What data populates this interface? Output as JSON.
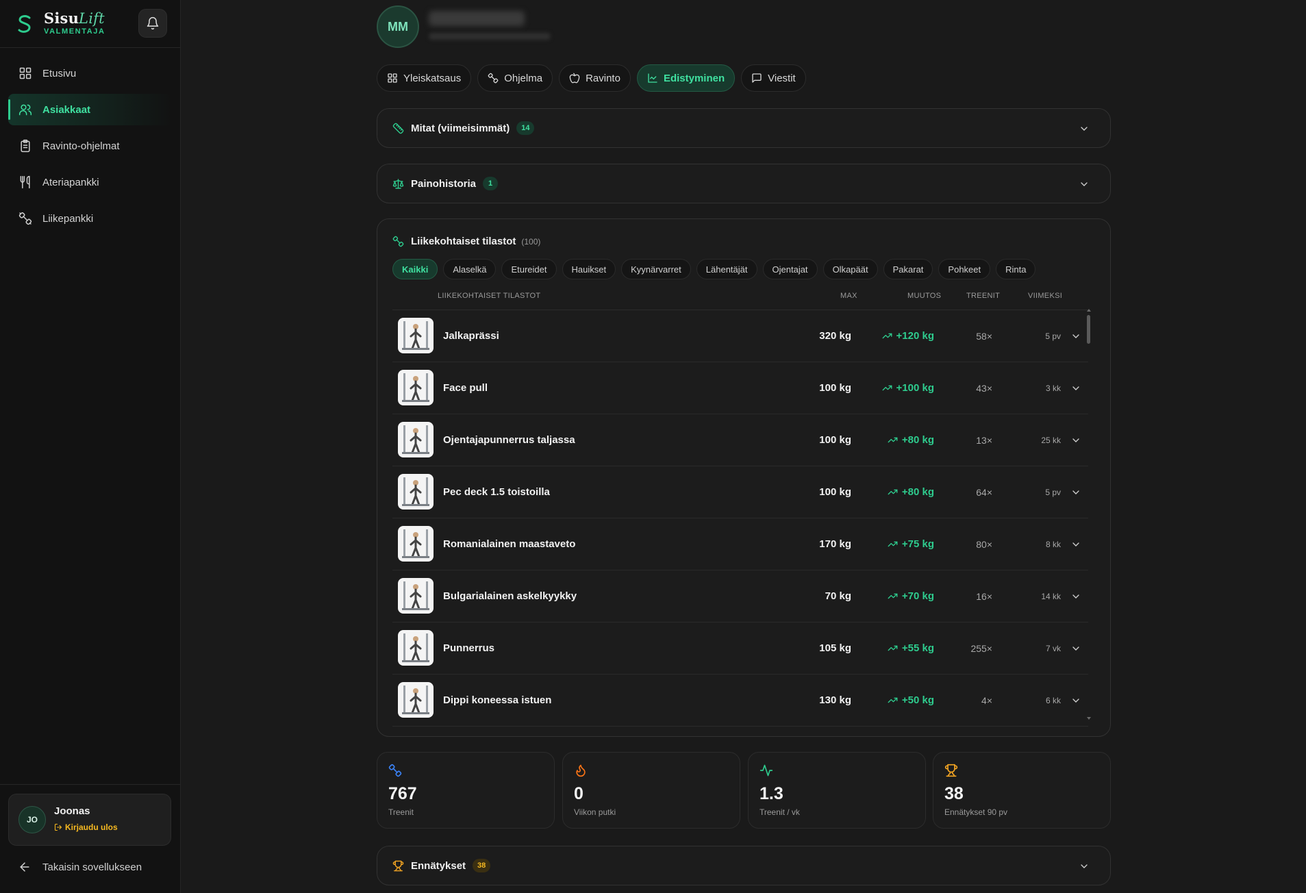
{
  "brand": {
    "name_a": "Sisu",
    "name_b": "Lift",
    "subtitle": "VALMENTAJA"
  },
  "colors": {
    "accent": "#2ecc8e",
    "gold": "#f5b820",
    "background": "#1a1a1a",
    "sidebar": "#121212"
  },
  "sidebar": {
    "items": [
      {
        "label": "Etusivu",
        "icon": "grid-icon"
      },
      {
        "label": "Asiakkaat",
        "icon": "users-icon",
        "active": true
      },
      {
        "label": "Ravinto-ohjelmat",
        "icon": "clipboard-icon"
      },
      {
        "label": "Ateriapankki",
        "icon": "utensils-icon"
      },
      {
        "label": "Liikepankki",
        "icon": "dumbbell-icon"
      }
    ],
    "user": {
      "initials": "JO",
      "name": "Joonas",
      "logout": "Kirjaudu ulos"
    },
    "back": "Takaisin sovellukseen"
  },
  "client": {
    "initials": "MM"
  },
  "tabs": [
    {
      "label": "Yleiskatsaus",
      "icon": "grid-icon"
    },
    {
      "label": "Ohjelma",
      "icon": "dumbbell-icon"
    },
    {
      "label": "Ravinto",
      "icon": "apple-icon"
    },
    {
      "label": "Edistyminen",
      "icon": "chart-line-icon",
      "active": true
    },
    {
      "label": "Viestit",
      "icon": "message-icon"
    }
  ],
  "measurements": {
    "title": "Mitat (viimeisimmät)",
    "count": "14"
  },
  "weight_history": {
    "title": "Painohistoria",
    "count": "1"
  },
  "exercise_stats": {
    "title": "Liikekohtaiset tilastot",
    "count": "(100)",
    "filters": [
      "Kaikki",
      "Alaselkä",
      "Etureidet",
      "Hauikset",
      "Kyynärvarret",
      "Lähentäjät",
      "Ojentajat",
      "Olkapäät",
      "Pakarat",
      "Pohkeet",
      "Rinta"
    ],
    "columns": {
      "name": "LIIKEKOHTAISET TILASTOT",
      "max": "MAX",
      "change": "MUUTOS",
      "sessions": "TREENIT",
      "last": "VIIMEKSI"
    },
    "rows": [
      {
        "name": "Jalkaprässi",
        "max": "320 kg",
        "change": "+120 kg",
        "sessions": "58×",
        "last": "5 pv"
      },
      {
        "name": "Face pull",
        "max": "100 kg",
        "change": "+100 kg",
        "sessions": "43×",
        "last": "3 kk"
      },
      {
        "name": "Ojentajapunnerrus taljassa",
        "max": "100 kg",
        "change": "+80 kg",
        "sessions": "13×",
        "last": "25 kk"
      },
      {
        "name": "Pec deck 1.5 toistoilla",
        "max": "100 kg",
        "change": "+80 kg",
        "sessions": "64×",
        "last": "5 pv"
      },
      {
        "name": "Romanialainen maastaveto",
        "max": "170 kg",
        "change": "+75 kg",
        "sessions": "80×",
        "last": "8 kk"
      },
      {
        "name": "Bulgarialainen askelkyykky",
        "max": "70 kg",
        "change": "+70 kg",
        "sessions": "16×",
        "last": "14 kk"
      },
      {
        "name": "Punnerrus",
        "max": "105 kg",
        "change": "+55 kg",
        "sessions": "255×",
        "last": "7 vk"
      },
      {
        "name": "Dippi koneessa istuen",
        "max": "130 kg",
        "change": "+50 kg",
        "sessions": "4×",
        "last": "6 kk"
      }
    ]
  },
  "stats": [
    {
      "value": "767",
      "label": "Treenit",
      "icon": "dumbbell-icon"
    },
    {
      "value": "0",
      "label": "Viikon putki",
      "icon": "flame-icon"
    },
    {
      "value": "1.3",
      "label": "Treenit / vk",
      "icon": "activity-icon"
    },
    {
      "value": "38",
      "label": "Ennätykset 90 pv",
      "icon": "trophy-icon"
    }
  ],
  "records": {
    "title": "Ennätykset",
    "count": "38"
  }
}
